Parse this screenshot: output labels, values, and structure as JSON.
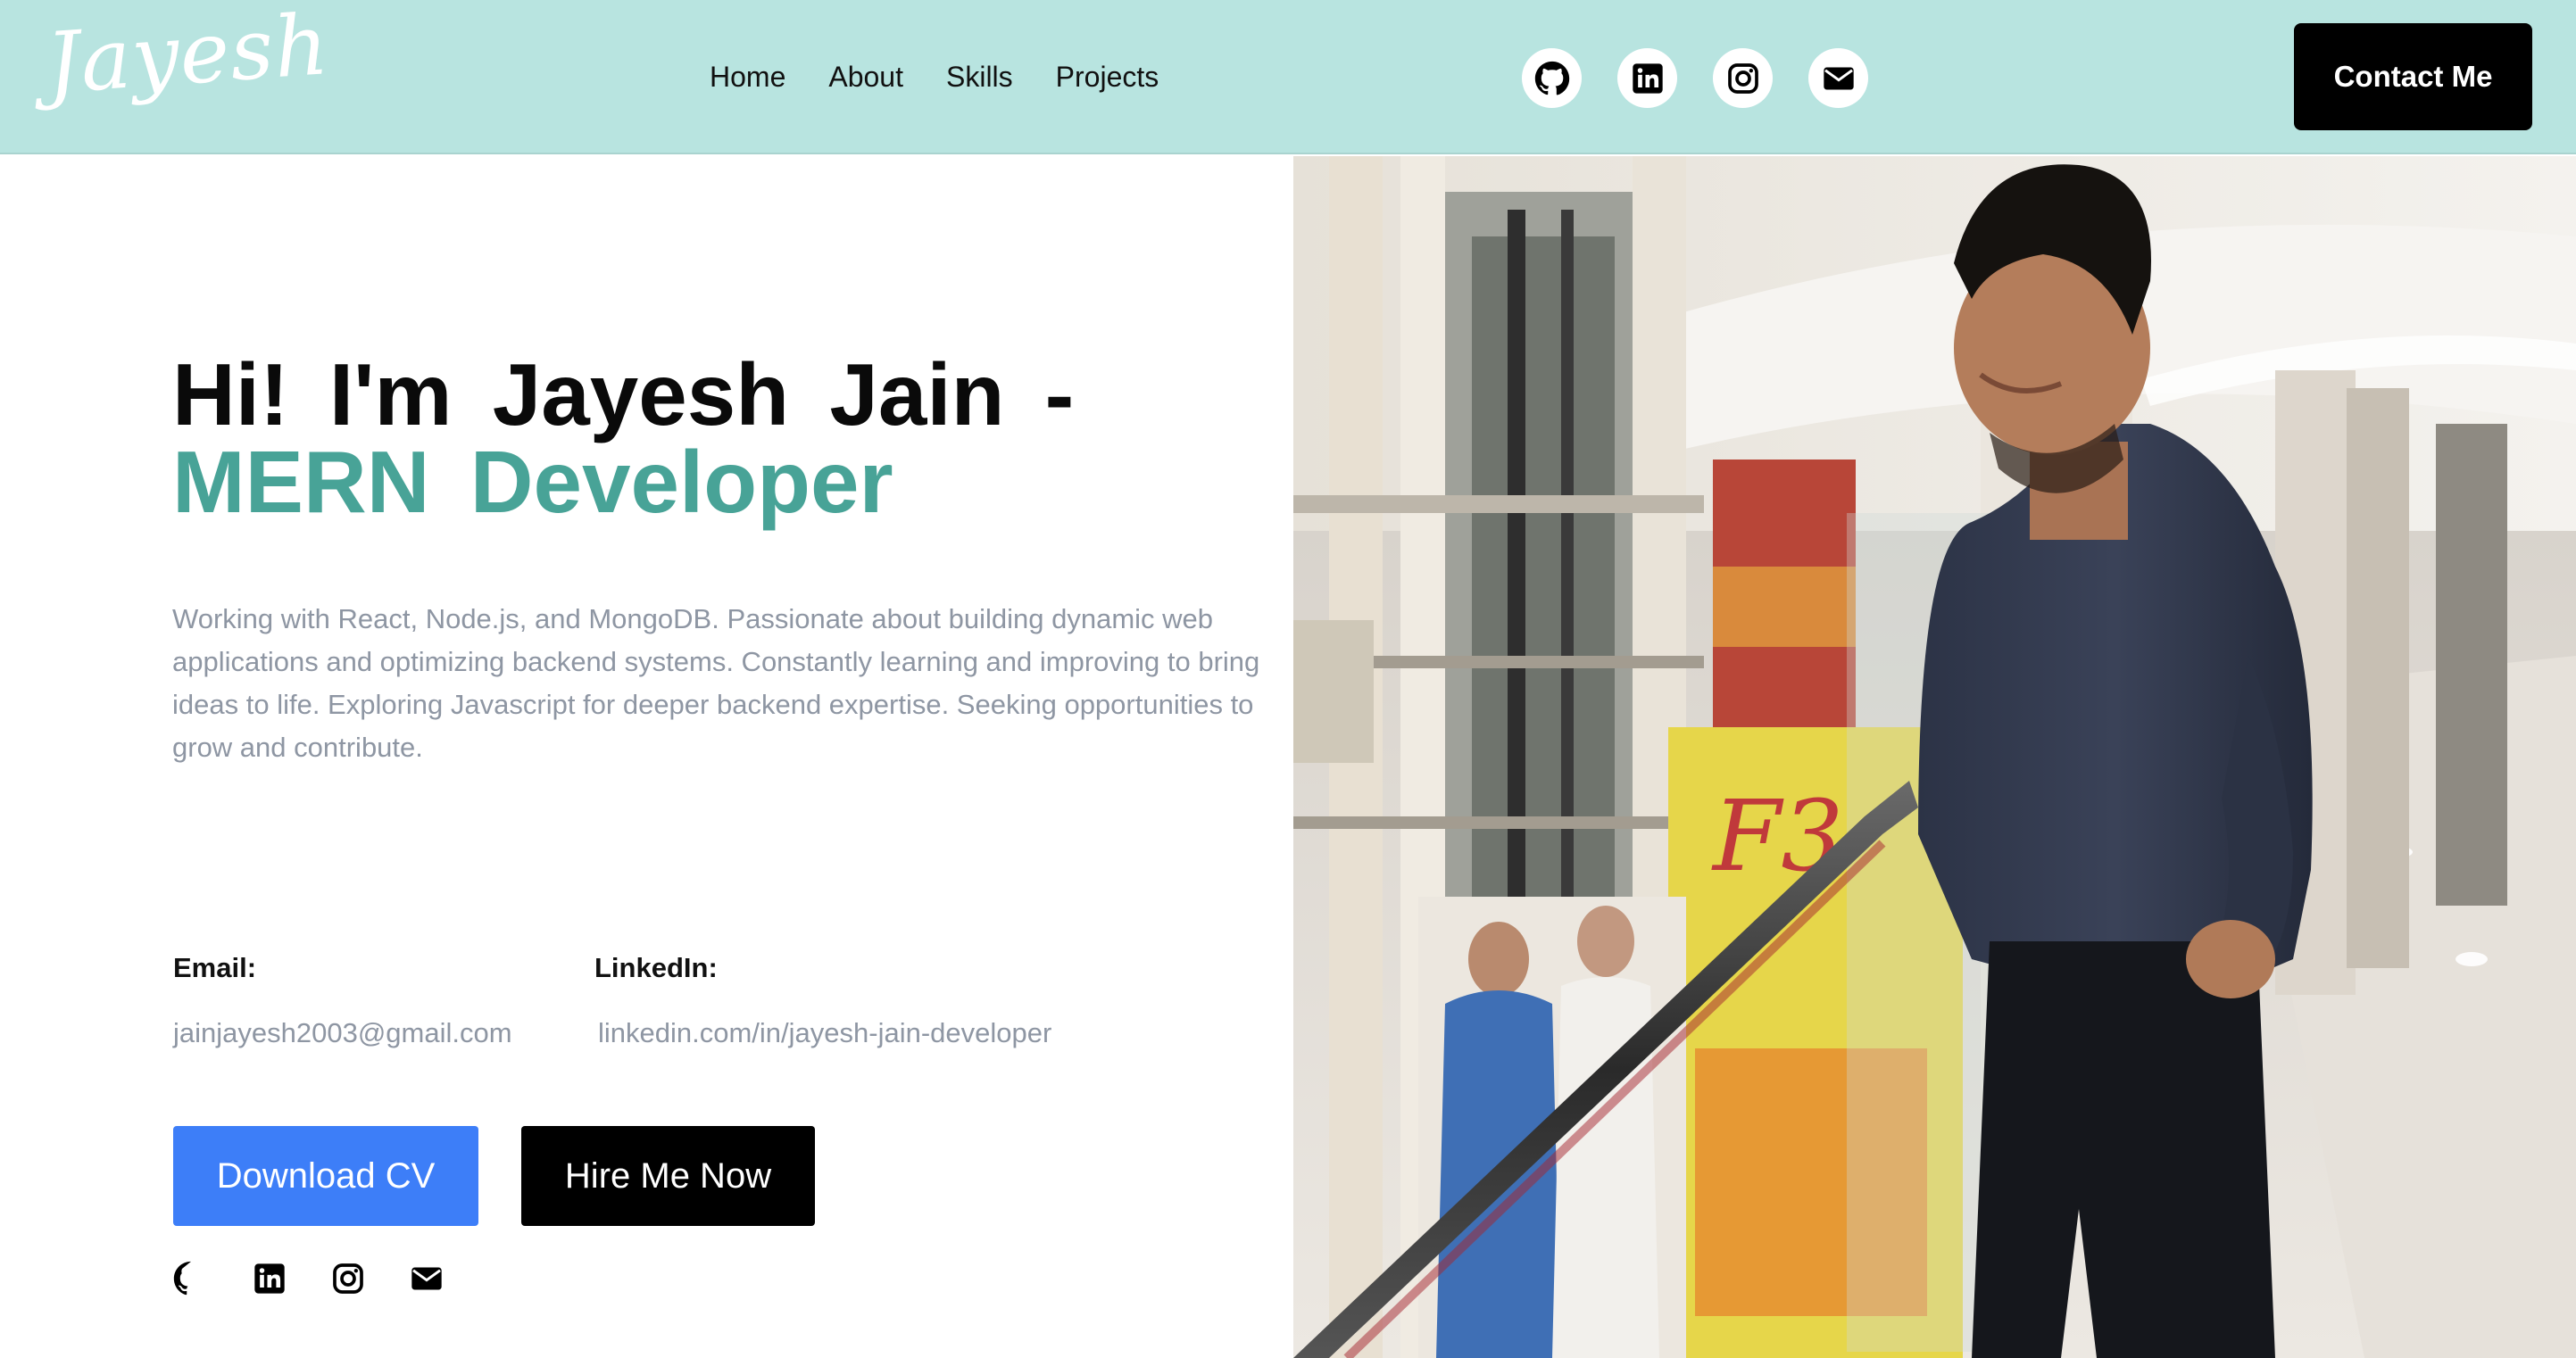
{
  "header": {
    "logo": "Jayesh",
    "nav": [
      {
        "label": "Home"
      },
      {
        "label": "About"
      },
      {
        "label": "Skills"
      },
      {
        "label": "Projects"
      }
    ],
    "social_icons": [
      "github-icon",
      "linkedin-icon",
      "instagram-icon",
      "email-icon"
    ],
    "contact_label": "Contact Me"
  },
  "hero": {
    "title_line1": "Hi! I'm Jayesh Jain -",
    "title_line2": "MERN Developer",
    "description": "Working with React, Node.js, and MongoDB. Passionate about building dynamic web applications and optimizing backend systems. Constantly learning and improving to bring ideas to life. Exploring Javascript for deeper backend expertise. Seeking opportunities to grow and contribute.",
    "email_label": "Email:",
    "email_value": "jainjayesh2003@gmail.com",
    "linkedin_label": "LinkedIn:",
    "linkedin_value": "linkedin.com/in/jayesh-jain-developer",
    "download_label": "Download CV",
    "hire_label": "Hire Me Now",
    "social_icons": [
      "github-icon",
      "linkedin-icon",
      "instagram-icon",
      "email-icon"
    ]
  },
  "photo": {
    "poster_text": "F3",
    "depicts": "portrait-photo"
  },
  "colors": {
    "navbar_bg": "#b8e4e0",
    "accent_teal": "#48a397",
    "primary_blue": "#3d7ef8",
    "text_muted": "#8e96a3",
    "black": "#000000"
  }
}
